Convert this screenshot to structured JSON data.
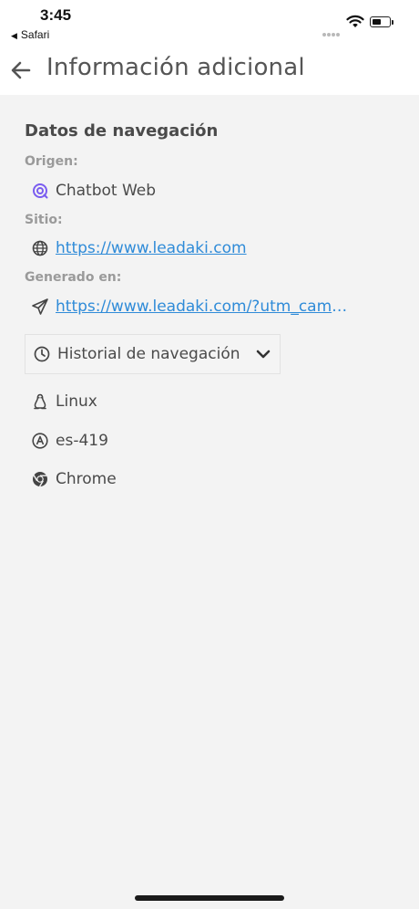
{
  "status_bar": {
    "time": "3:45",
    "back_app_label": "Safari"
  },
  "header": {
    "title": "Información adicional",
    "back_icon": "arrow-left-icon"
  },
  "section": {
    "title": "Datos de navegación",
    "origin_label": "Origen:",
    "origin_value": "Chatbot Web",
    "site_label": "Sitio:",
    "site_url": "https://www.leadaki.com",
    "generated_label": "Generado en:",
    "generated_url": "https://www.leadaki.com/?utm_campaig..."
  },
  "history": {
    "label": "Historial de navegación",
    "expanded": false
  },
  "device": {
    "os": "Linux",
    "language": "es-419",
    "browser": "Chrome"
  },
  "colors": {
    "accent_link": "#2f8bd8",
    "chatbot_icon": "#7a5cf0",
    "background": "#f3f3f3"
  }
}
